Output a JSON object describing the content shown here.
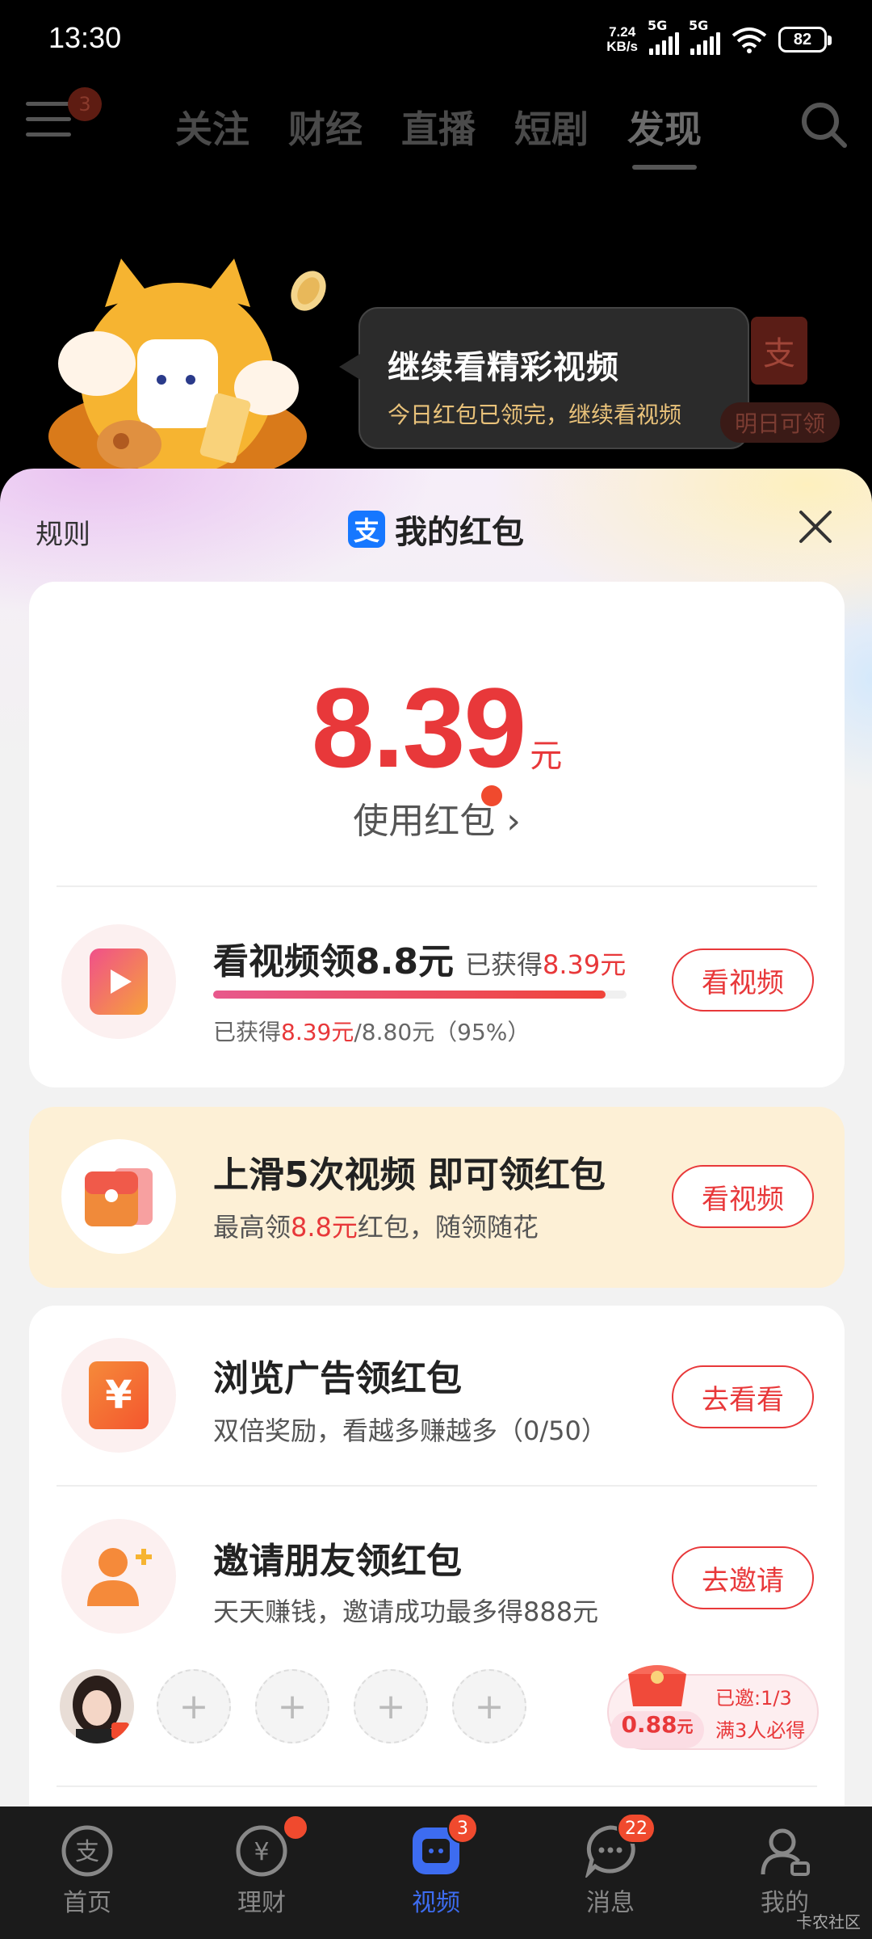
{
  "status_bar": {
    "time": "13:30",
    "speed_value": "7.24",
    "speed_unit": "KB/s",
    "net1": "5G",
    "net2": "5G",
    "battery": "82"
  },
  "top_tabs": {
    "menu_badge": "3",
    "tabs": [
      "关注",
      "财经",
      "直播",
      "短剧",
      "发现"
    ],
    "active_tab": "发现"
  },
  "tooltip": {
    "title": "继续看精彩视频",
    "subtitle": "今日红包已领完，继续看视频"
  },
  "tomorrow": {
    "icon_char": "支",
    "label": "明日可领"
  },
  "sheet": {
    "rules": "规则",
    "logo_char": "支",
    "title": "我的红包",
    "amount": "8.39",
    "amount_unit": "元",
    "use_link": "使用红包",
    "tasks": [
      {
        "title": "看视频领8.8元",
        "earned_prefix": "已获得",
        "earned_value": "8.39元",
        "progress_prefix": "已获得",
        "progress_value": "8.39元",
        "progress_rest": "/8.80元（95%）",
        "progress": 0.95,
        "button": "看视频"
      },
      {
        "title": "上滑5次视频 即可领红包",
        "sub_prefix": "最高领",
        "sub_value": "8.8元",
        "sub_rest": "红包，随领随花",
        "button": "看视频"
      },
      {
        "title": "浏览广告领红包",
        "sub": "双倍奖励，看越多赚越多（0/50）",
        "button": "去看看",
        "icon_char": "¥"
      },
      {
        "title": "邀请朋友领红包",
        "sub": "天天赚钱，邀请成功最多得888元",
        "button": "去邀请"
      }
    ],
    "invite": {
      "slot_symbol": "+",
      "reward_value": "0.88",
      "reward_unit": "元",
      "invited": "已邀:1/3",
      "requirement": "满3人必得"
    }
  },
  "nav": {
    "items": [
      {
        "label": "首页",
        "badge": ""
      },
      {
        "label": "理财",
        "badge": ""
      },
      {
        "label": "视频",
        "badge": "3"
      },
      {
        "label": "消息",
        "badge": "22"
      },
      {
        "label": "我的",
        "badge": ""
      }
    ],
    "active": "视频"
  },
  "watermark": "卡农社区",
  "colors": {
    "accent_red": "#e8383a",
    "alipay_blue": "#1677ff",
    "nav_active": "#3d6cf0",
    "badge_red": "#f04a2e"
  }
}
